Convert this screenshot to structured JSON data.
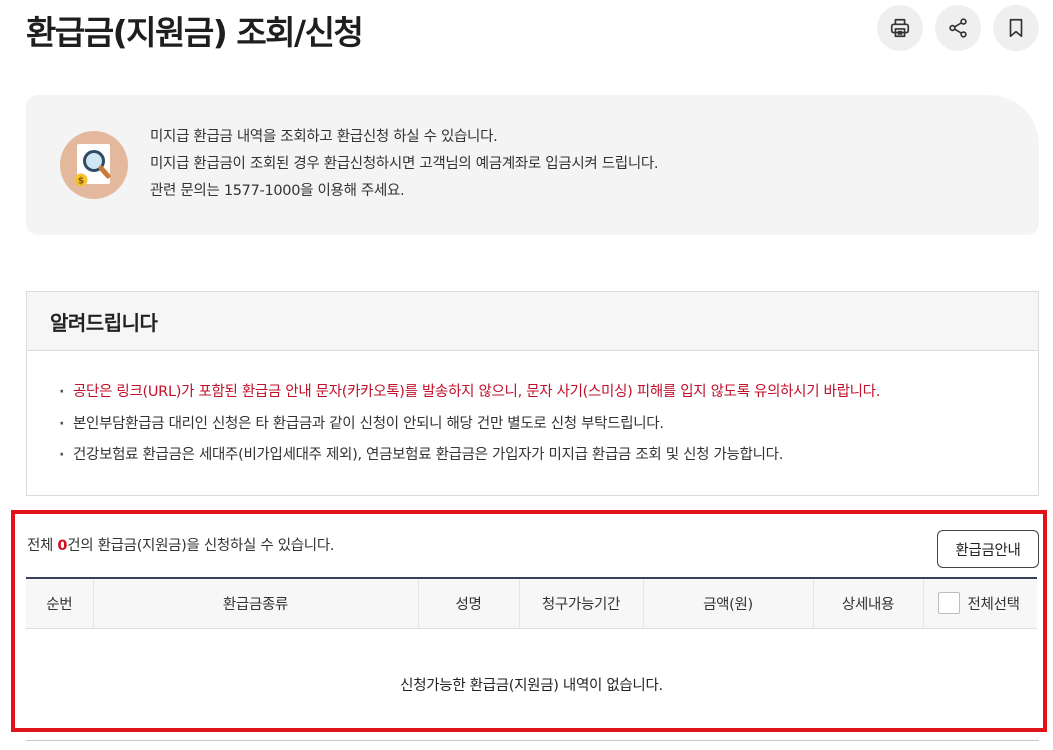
{
  "page": {
    "title": "환급금(지원금) 조회/신청"
  },
  "toolbar": {
    "print_icon": "printer-icon",
    "share_icon": "share-icon",
    "bookmark_icon": "bookmark-icon"
  },
  "info": {
    "icon": "search-document-coin-icon",
    "lines": [
      "미지급 환급금 내역을 조회하고 환급신청 하실 수 있습니다.",
      "미지급 환급금이 조회된 경우 환급신청하시면 고객님의 예금계좌로 입금시켜 드립니다.",
      "관련 문의는 1577-1000을 이용해 주세요."
    ]
  },
  "notice": {
    "heading": "알려드립니다",
    "items": [
      "공단은 링크(URL)가 포함된 환급금 안내 문자(카카오톡)를 발송하지 않으니, 문자 사기(스미싱) 피해를 입지 않도록 유의하시기 바랍니다.",
      "본인부담환급금 대리인 신청은 타 환급금과 같이 신청이 안되니 해당 건만 별도로 신청 부탁드립니다.",
      "건강보험료 환급금은 세대주(비가입세대주 제외), 연금보험료 환급금은 가입자가 미지급 환급금 조회 및 신청 가능합니다."
    ]
  },
  "refund": {
    "count_prefix": "전체 ",
    "count": "0",
    "count_suffix": "건의 환급금(지원금)을 신청하실 수 있습니다.",
    "guide_button": "환급금안내",
    "columns": [
      "순번",
      "환급금종류",
      "성명",
      "청구가능기간",
      "금액(원)",
      "상세내용"
    ],
    "select_all_label": "전체선택",
    "empty_message": "신청가능한 환급금(지원금) 내역이 없습니다."
  },
  "colors": {
    "accent_red": "#d10f20",
    "highlight_border": "#e0121a",
    "table_top_border": "#3a3f58"
  }
}
